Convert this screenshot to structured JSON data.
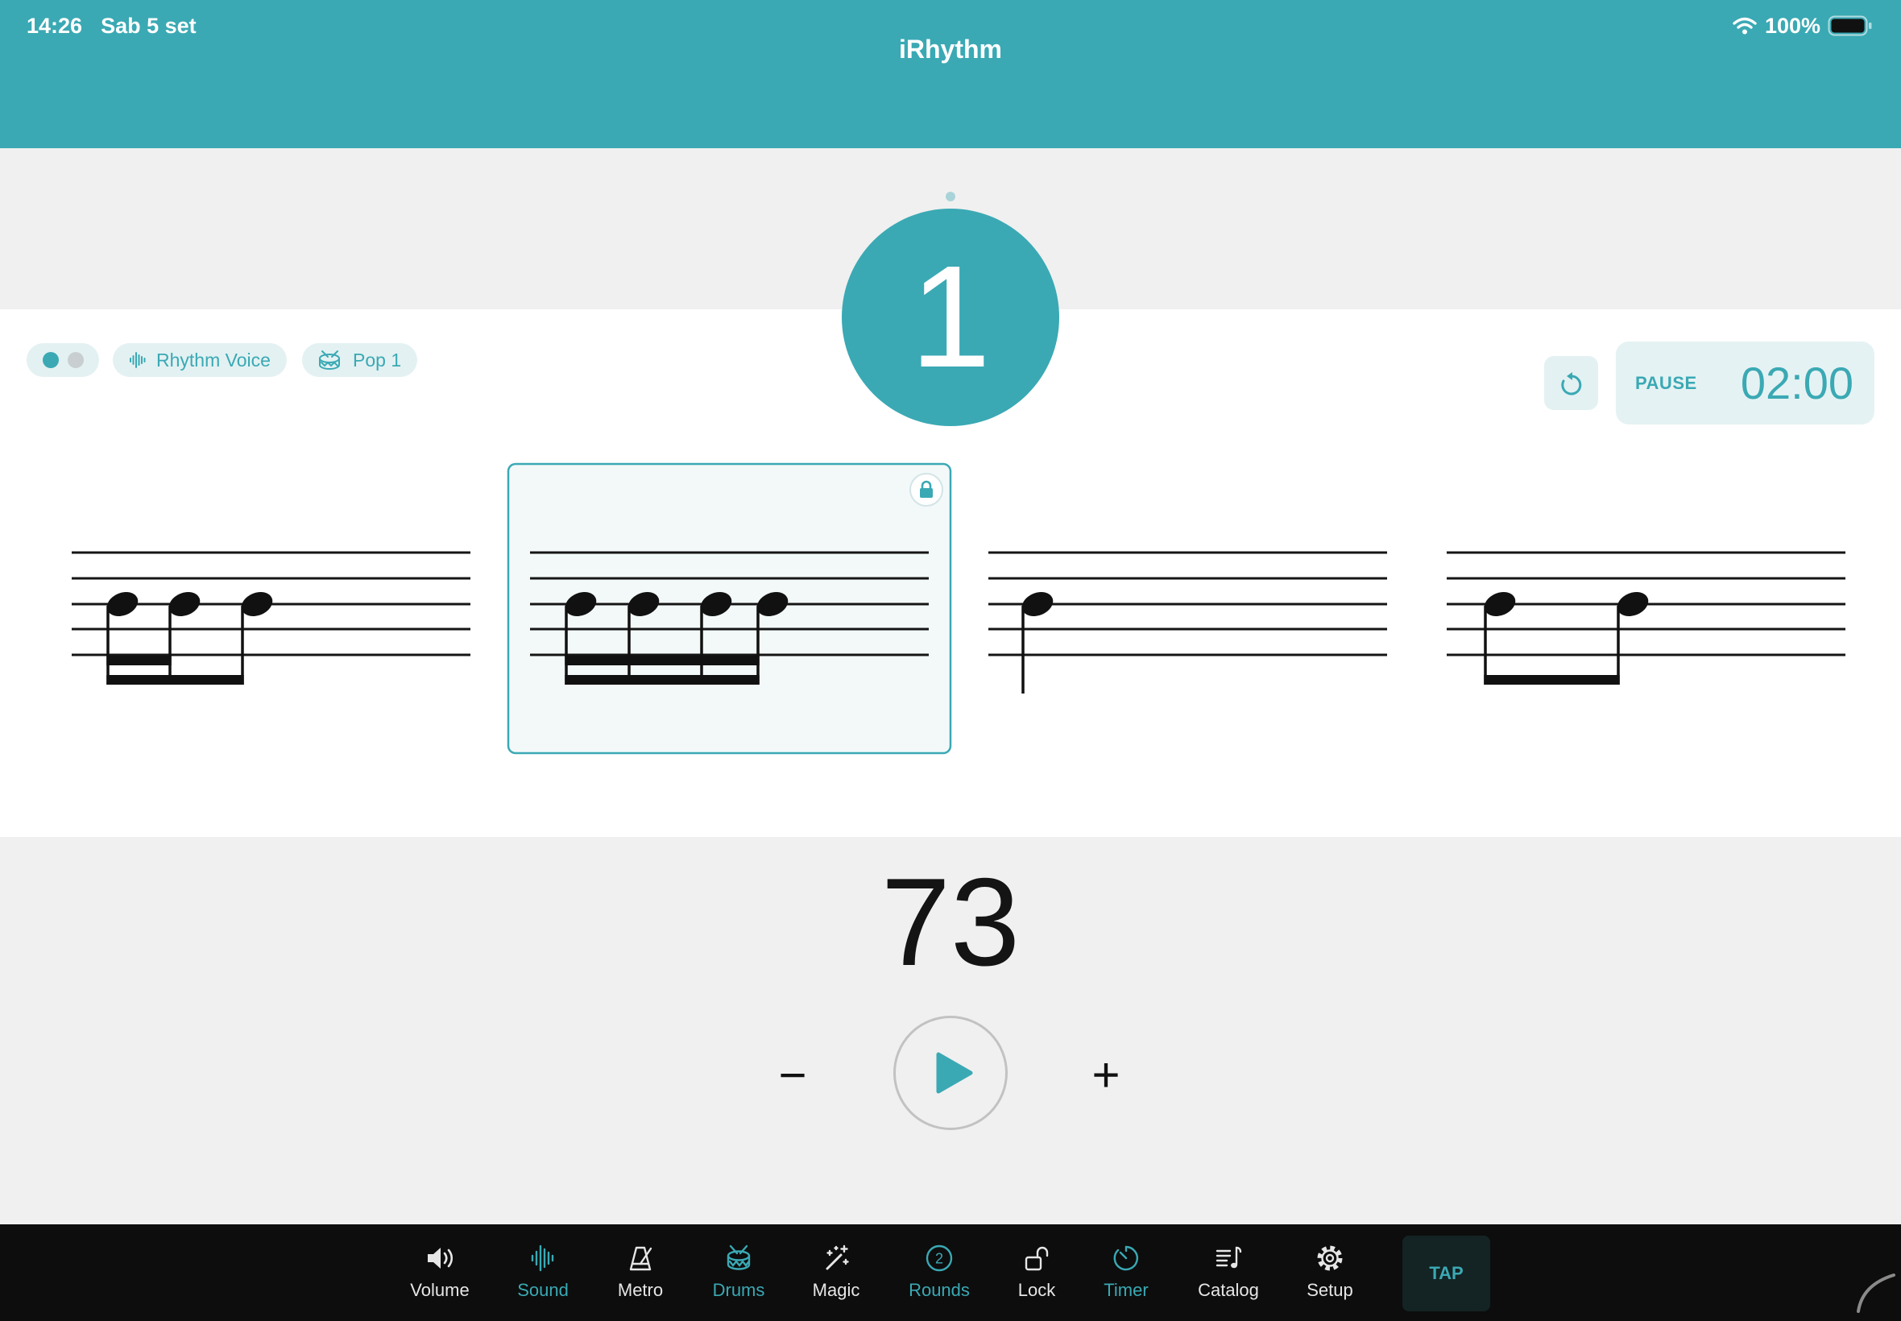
{
  "status_bar": {
    "time": "14:26",
    "date": "Sab 5 set",
    "battery": "100%",
    "wifi_icon": "wifi-icon",
    "battery_icon": "battery-icon"
  },
  "app": {
    "title": "iRhythm"
  },
  "colors": {
    "accent": "#3AA9B4",
    "chip_bg": "#E3F1F2",
    "tab_bar_bg": "#0D0D0D",
    "tab_inactive": "#E6E6E6"
  },
  "beat_counter": {
    "current_beat": "1"
  },
  "chips": {
    "toggle": {
      "active_index": 0
    },
    "voice": {
      "label": "Rhythm Voice",
      "icon": "waveform-icon"
    },
    "drum_kit": {
      "label": "Pop 1",
      "icon": "drum-icon"
    }
  },
  "timer": {
    "reset_icon": "counterclockwise-arrow-icon",
    "state_label": "PAUSE",
    "time": "02:00"
  },
  "measures": [
    {
      "durations": [
        16,
        16,
        8
      ],
      "selected": false,
      "locked": false
    },
    {
      "durations": [
        16,
        16,
        16,
        16
      ],
      "selected": true,
      "locked": true
    },
    {
      "durations": [
        4
      ],
      "selected": false,
      "locked": false
    },
    {
      "durations": [
        8,
        8
      ],
      "selected": false,
      "locked": false
    }
  ],
  "tempo": {
    "bpm": "73",
    "decrement_label": "−",
    "increment_label": "+",
    "play_icon": "play-icon"
  },
  "tab_bar": {
    "items": [
      {
        "label": "Volume",
        "icon": "speaker-icon",
        "active": false
      },
      {
        "label": "Sound",
        "icon": "waveform-icon",
        "active": true
      },
      {
        "label": "Metro",
        "icon": "metronome-icon",
        "active": false
      },
      {
        "label": "Drums",
        "icon": "drum-icon",
        "active": true
      },
      {
        "label": "Magic",
        "icon": "magic-wand-icon",
        "active": false
      },
      {
        "label": "Rounds",
        "icon": "rounds-icon",
        "active": true
      },
      {
        "label": "Lock",
        "icon": "unlock-icon",
        "active": false
      },
      {
        "label": "Timer",
        "icon": "timer-icon",
        "active": true
      },
      {
        "label": "Catalog",
        "icon": "catalog-icon",
        "active": false
      },
      {
        "label": "Setup",
        "icon": "gear-icon",
        "active": false
      }
    ],
    "rounds_badge": "2",
    "tap_label": "TAP"
  }
}
